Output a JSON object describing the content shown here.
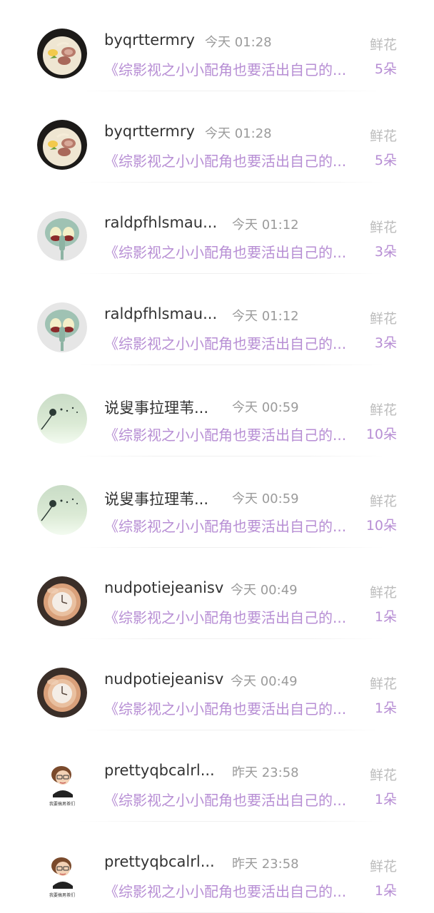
{
  "gift_records": [
    {
      "user": "byqrttermry",
      "time": "今天 01:28",
      "gift_label": "鲜花",
      "book": "《综影视之小小配角也要活出自己的...",
      "count": "5朵",
      "avatar": "noodle-bowl-avatar"
    },
    {
      "user": "byqrttermry",
      "time": "今天 01:28",
      "gift_label": "鲜花",
      "book": "《综影视之小小配角也要活出自己的...",
      "count": "5朵",
      "avatar": "noodle-bowl-avatar"
    },
    {
      "user": "raldpfhlsmau...",
      "time": "今天 01:12",
      "gift_label": "鲜花",
      "book": "《综影视之小小配角也要活出自己的...",
      "count": "3朵",
      "avatar": "squidward-avatar"
    },
    {
      "user": "raldpfhlsmau...",
      "time": "今天 01:12",
      "gift_label": "鲜花",
      "book": "《综影视之小小配角也要活出自己的...",
      "count": "3朵",
      "avatar": "squidward-avatar"
    },
    {
      "user": "说叟事拉理苇...",
      "time": "今天 00:59",
      "gift_label": "鲜花",
      "book": "《综影视之小小配角也要活出自己的...",
      "count": "10朵",
      "avatar": "dandelion-avatar"
    },
    {
      "user": "说叟事拉理苇...",
      "time": "今天 00:59",
      "gift_label": "鲜花",
      "book": "《综影视之小小配角也要活出自己的...",
      "count": "10朵",
      "avatar": "dandelion-avatar"
    },
    {
      "user": "nudpotiejeanisv",
      "time": "今天 00:49",
      "gift_label": "鲜花",
      "book": "《综影视之小小配角也要活出自己的...",
      "count": "1朵",
      "avatar": "watch-avatar"
    },
    {
      "user": "nudpotiejeanisv",
      "time": "今天 00:49",
      "gift_label": "鲜花",
      "book": "《综影视之小小配角也要活出自己的...",
      "count": "1朵",
      "avatar": "watch-avatar"
    },
    {
      "user": "prettyqbcalrl...",
      "time": "昨天 23:58",
      "gift_label": "鲜花",
      "book": "《综影视之小小配角也要活出自己的...",
      "count": "1朵",
      "avatar": "cartoon-girl-avatar",
      "avatar_caption": "我要搞男茶们"
    },
    {
      "user": "prettyqbcalrl...",
      "time": "昨天 23:58",
      "gift_label": "鲜花",
      "book": "《综影视之小小配角也要活出自己的...",
      "count": "1朵",
      "avatar": "cartoon-girl-avatar",
      "avatar_caption": "我要搞男茶们"
    }
  ]
}
